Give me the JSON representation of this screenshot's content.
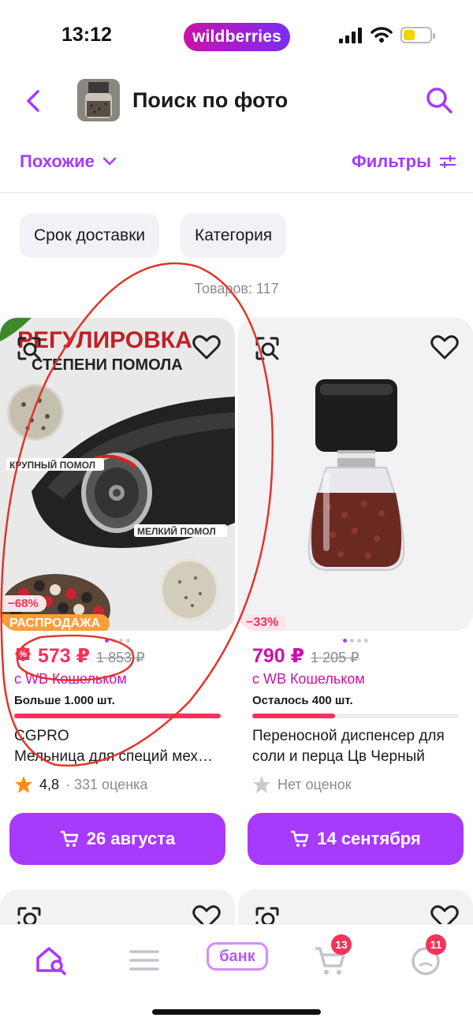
{
  "status": {
    "time": "13:12",
    "brand": "wildberries"
  },
  "header": {
    "title": "Поиск по фото"
  },
  "sort": {
    "label": "Похожие"
  },
  "filters": {
    "label": "Фильтры"
  },
  "chips": [
    "Срок доставки",
    "Категория"
  ],
  "count_text": "Товаров: 117",
  "products": [
    {
      "discount": "−68%",
      "sale_badge": "РАСПРОДАЖА",
      "price": "573 ₽",
      "old_price": "1 853 ₽",
      "wallet": "с WB Кошельком",
      "stock": "Больше 1.000 шт.",
      "stock_level": 1.0,
      "brand": "CGPRO",
      "name": "Мельница для специй мех…",
      "rating": "4,8",
      "reviews": "· 331 оценка",
      "delivery": "26 августа",
      "image_text_1": "РЕГУЛИРОВКА",
      "image_text_2": "СТЕПЕНИ ПОМОЛА",
      "image_text_3": "КРУПНЫЙ ПОМОЛ",
      "image_text_4": "МЕЛКИЙ ПОМОЛ"
    },
    {
      "discount": "−33%",
      "price": "790 ₽",
      "old_price": "1 205 ₽",
      "wallet": "с WB Кошельком",
      "stock": "Осталось 400 шт.",
      "stock_level": 0.4,
      "name": "Переносной диспенсер для соли и перца Цв Черный",
      "rating_text": "Нет оценок",
      "delivery": "14 сентября"
    }
  ],
  "tabbar": {
    "bank": "банк",
    "cart_count": "13",
    "profile_count": "11"
  },
  "colors": {
    "accent": "#a73afd",
    "price": "#f5325c",
    "wallet": "#cb11ab"
  }
}
